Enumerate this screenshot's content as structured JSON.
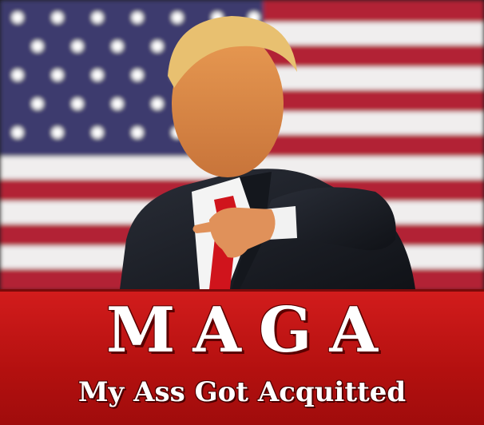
{
  "banner": {
    "headline": "MAGA",
    "tagline": "My Ass Got Acquitted"
  },
  "colors": {
    "banner_red": "#c4161c",
    "flag_red": "#b22234",
    "flag_blue": "#3c3b6e",
    "flag_white": "#f2f2f2",
    "suit": "#1c1f26",
    "tie": "#d0141c"
  },
  "scene": {
    "background": "american-flag",
    "subject": "figure-in-dark-suit-pointing"
  }
}
